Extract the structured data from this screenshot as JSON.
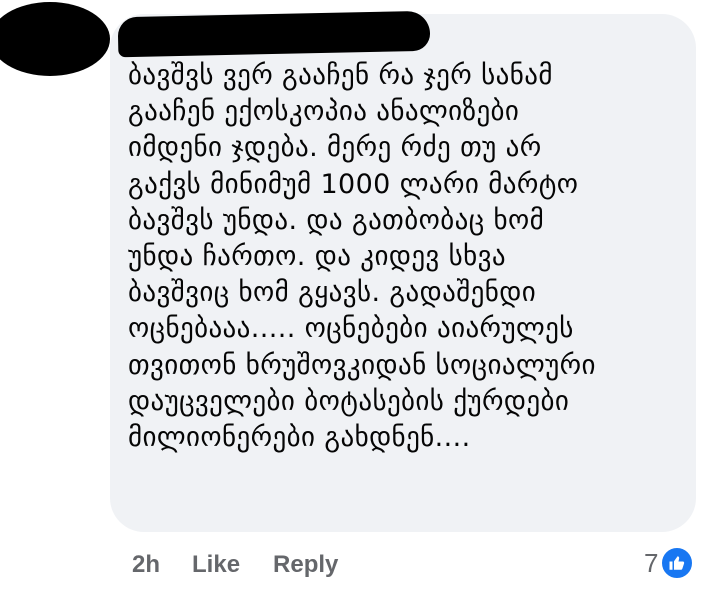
{
  "comment": {
    "author": "",
    "lines": [
      "ბავშვს ვერ გააჩენ რა ჯერ სანამ",
      "გააჩენ ექოსკოპია ანალიზები",
      "იმდენი ჯდება. მერე რძე თუ არ",
      "გაქვს მინიმუმ 1000 ლარი მარტო",
      "ბავშვს უნდა. და გათბობაც ხომ",
      "უნდა ჩართო. და კიდევ სხვა",
      "ბავშვიც ხომ გყავს. გადაშენდი",
      "ოცნებააა..... ოცნებები აიარულეს",
      "თვითონ ხრუშოვკიდან სოციალური",
      "დაუცველები ბოტასების ქურდები",
      "მილიონერები გახდნენ...."
    ]
  },
  "meta": {
    "time": "2h",
    "like_label": "Like",
    "reply_label": "Reply"
  },
  "reactions": {
    "count": "7",
    "icon": "thumbs-up-icon",
    "color": "#1877f2"
  },
  "colors": {
    "bubble": "#f0f2f5",
    "text": "#050505",
    "secondary": "#65676b"
  }
}
